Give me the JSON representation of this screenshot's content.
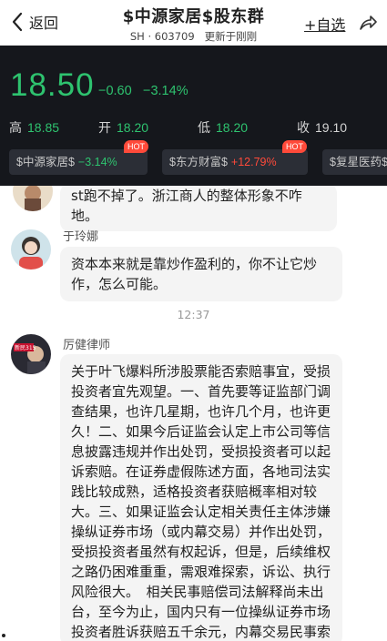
{
  "header": {
    "back_label": "返回",
    "title": "$中源家居$股东群",
    "code": "SH · 603709",
    "update": "更新于刚刚",
    "follow_label": "+自选"
  },
  "quote": {
    "price": "18.50",
    "change": "−0.60",
    "change_pct": "−3.14%",
    "high_label": "高",
    "high": "18.85",
    "open_label": "开",
    "open": "18.20",
    "low_label": "低",
    "low": "18.20",
    "volume_label": "收",
    "volume": "19.10",
    "colors": {
      "down": "#2ec36f",
      "up": "#ff4a3a",
      "bg": "#15171c"
    }
  },
  "chips": [
    {
      "name": "$中源家居$",
      "pct": "−3.14%",
      "badge": "HOT"
    },
    {
      "name": "$东方财富$",
      "pct": "+12.79%",
      "badge": "HOT"
    },
    {
      "name": "$复星医药$",
      "pct": "",
      "badge": ""
    }
  ],
  "messages": [
    {
      "sender": "",
      "text": "st跑不掉了。浙江商人的整体形象不咋地。"
    },
    {
      "sender": "于玲娜",
      "text": "资本本来就是靠炒作盈利的，你不让它炒作，怎么可能。"
    },
    {
      "sender": "厉健律师",
      "text": "关于叶飞爆料所涉股票能否索赔事宜，受损投资者宜先观望。一、首先要等证监部门调查结果，也许几星期，也许几个月，也许更久！二、如果今后证监会认定上市公司等信息披露违规并作出处罚，受损投资者可以起诉索赔。在证券虚假陈述方面，各地司法实践比较成熟，适格投资者获赔概率相对较大。三、如果证监会认定相关责任主体涉嫌操纵证券市场（或内幕交易）并作出处罚，受损投资者虽然有权起诉，但是，后续维权之路仍困难重重，需艰难探索，诉讼、执行风险很大。　相关民事赔偿司法解释尚未出台，至今为止，国内只有一位操纵证券市场投资者胜诉获赔五千余元，内幕交易民事索赔仅有光大证券一案投资者胜诉。"
    }
  ],
  "timestamp": "12:37",
  "avatar_badge": "新民315"
}
